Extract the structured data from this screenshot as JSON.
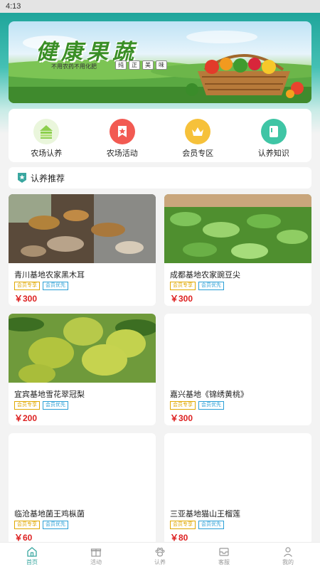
{
  "status_bar": {
    "time": "4:13"
  },
  "banner": {
    "title": "健康果蔬",
    "slogan": "不用农药不用化肥",
    "tags": [
      "纯",
      "正",
      "美",
      "味"
    ]
  },
  "entries": [
    {
      "label": "农场认养",
      "icon": "greenhouse-icon",
      "color": "#eaf6dc"
    },
    {
      "label": "农场活动",
      "icon": "star-flag-icon",
      "color": "#f25a52"
    },
    {
      "label": "会员专区",
      "icon": "crown-icon",
      "color": "#f6c13a"
    },
    {
      "label": "认养知识",
      "icon": "book-icon",
      "color": "#3fc5a5"
    }
  ],
  "section": {
    "title": "认养推荐"
  },
  "products": [
    {
      "name": "青川基地农家黑木耳",
      "badge_vip": "会员专享",
      "badge_pri": "会员优先",
      "price": "￥300"
    },
    {
      "name": "成都基地农家豌豆尖",
      "badge_vip": "会员专享",
      "badge_pri": "会员优先",
      "price": "￥300"
    },
    {
      "name": "宜宾基地雪花翠冠梨",
      "badge_vip": "会员专享",
      "badge_pri": "会员优先",
      "price": "￥200"
    },
    {
      "name": "嘉兴基地《锦绣黄桃》",
      "badge_vip": "会员专享",
      "badge_pri": "会员优先",
      "price": "￥300"
    },
    {
      "name": "临沧基地菌王鸡枞菌",
      "badge_vip": "会员专享",
      "badge_pri": "会员优先",
      "price": "￥60"
    },
    {
      "name": "三亚基地猫山王榴莲",
      "badge_vip": "会员专享",
      "badge_pri": "会员优先",
      "price": "￥80"
    }
  ],
  "tabbar": [
    {
      "label": "首页",
      "icon": "home-icon",
      "active": true
    },
    {
      "label": "活动",
      "icon": "gift-icon",
      "active": false
    },
    {
      "label": "认养",
      "icon": "paw-icon",
      "active": false
    },
    {
      "label": "客服",
      "icon": "inbox-icon",
      "active": false
    },
    {
      "label": "我的",
      "icon": "user-icon",
      "active": false
    }
  ],
  "colors": {
    "accent": "#3aa7a0",
    "price": "#dd2222",
    "vip": "#e0a800",
    "priority": "#2a9fd6"
  }
}
